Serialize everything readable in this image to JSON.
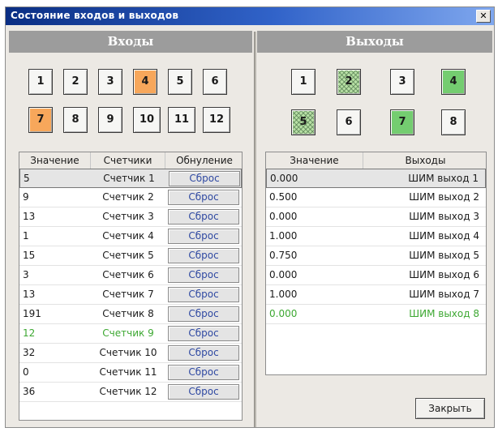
{
  "window": {
    "title": "Состояние входов и выходов",
    "close_glyph": "✕"
  },
  "inputs": {
    "header": "Входы",
    "buttons": [
      {
        "label": "1",
        "state": "off"
      },
      {
        "label": "2",
        "state": "off"
      },
      {
        "label": "3",
        "state": "off"
      },
      {
        "label": "4",
        "state": "on"
      },
      {
        "label": "5",
        "state": "off"
      },
      {
        "label": "6",
        "state": "off"
      },
      {
        "label": "7",
        "state": "on"
      },
      {
        "label": "8",
        "state": "off"
      },
      {
        "label": "9",
        "state": "off"
      },
      {
        "label": "10",
        "state": "off"
      },
      {
        "label": "11",
        "state": "off"
      },
      {
        "label": "12",
        "state": "off"
      }
    ],
    "columns": [
      "Значение",
      "Счетчики",
      "Обнуление"
    ],
    "reset_label": "Сброс",
    "rows": [
      {
        "value": "5",
        "counter": "Счетчик 1",
        "selected": true
      },
      {
        "value": "9",
        "counter": "Счетчик 2"
      },
      {
        "value": "13",
        "counter": "Счетчик 3"
      },
      {
        "value": "1",
        "counter": "Счетчик 4"
      },
      {
        "value": "15",
        "counter": "Счетчик 5"
      },
      {
        "value": "3",
        "counter": "Счетчик 6"
      },
      {
        "value": "13",
        "counter": "Счетчик 7"
      },
      {
        "value": "191",
        "counter": "Счетчик 8"
      },
      {
        "value": "12",
        "counter": "Счетчик 9",
        "highlight": true
      },
      {
        "value": "32",
        "counter": "Счетчик 10"
      },
      {
        "value": "0",
        "counter": "Счетчик 11"
      },
      {
        "value": "36",
        "counter": "Счетчик 12"
      }
    ]
  },
  "outputs": {
    "header": "Выходы",
    "buttons": [
      {
        "label": "1",
        "state": "off"
      },
      {
        "label": "2",
        "state": "pwm"
      },
      {
        "label": "3",
        "state": "off"
      },
      {
        "label": "4",
        "state": "on"
      },
      {
        "label": "5",
        "state": "pwm"
      },
      {
        "label": "6",
        "state": "off"
      },
      {
        "label": "7",
        "state": "on"
      },
      {
        "label": "8",
        "state": "off"
      }
    ],
    "columns": [
      "Значение",
      "Выходы"
    ],
    "rows": [
      {
        "value": "0.000",
        "output": "ШИМ выход 1",
        "selected": true
      },
      {
        "value": "0.500",
        "output": "ШИМ выход 2"
      },
      {
        "value": "0.000",
        "output": "ШИМ выход 3"
      },
      {
        "value": "1.000",
        "output": "ШИМ выход 4"
      },
      {
        "value": "0.750",
        "output": "ШИМ выход 5"
      },
      {
        "value": "0.000",
        "output": "ШИМ выход 6"
      },
      {
        "value": "1.000",
        "output": "ШИМ выход 7"
      },
      {
        "value": "0.000",
        "output": "ШИМ выход 8",
        "highlight": true
      }
    ]
  },
  "footer": {
    "close_label": "Закрыть"
  },
  "colors": {
    "on_input": "#f7a75b",
    "on_output": "#74cd70",
    "pwm_output": "#b8e0a5",
    "highlight_text": "#3da832",
    "reset_text": "#2f49a2"
  }
}
